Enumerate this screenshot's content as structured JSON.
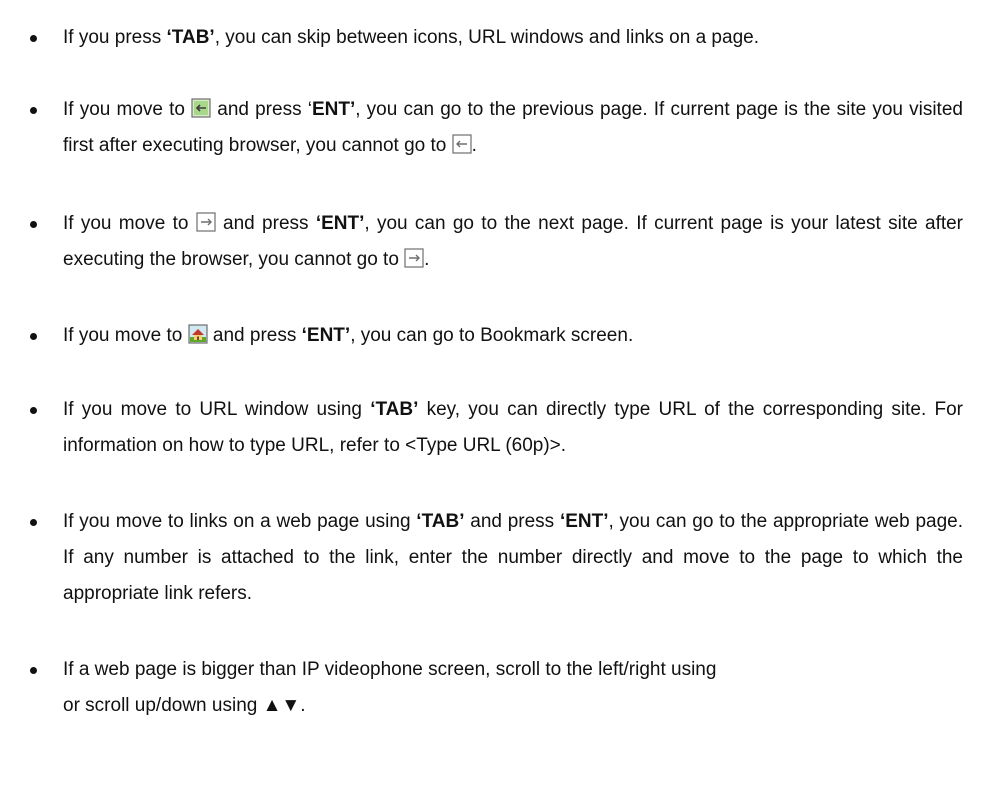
{
  "bullets": [
    {
      "p1": "If you press ",
      "k1": "‘TAB’",
      "p2": ", you can skip between icons, URL windows and links on a page."
    },
    {
      "p1": "If you move to ",
      "p2": " and press ‘",
      "k1": "ENT’",
      "p3": ", you can go to the previous page. If current page is the site you visited first after executing browser, you cannot go to ",
      "p4": "."
    },
    {
      "p1": "If you move to ",
      "p2": " and press ",
      "k1": "‘ENT’",
      "p3": ", you can go to the next page. If current page is your latest site after executing the browser, you cannot go to ",
      "p4": "."
    },
    {
      "p1": "If you move to ",
      "p2": " and press ",
      "k1": "‘ENT’",
      "p3": ", you can go to Bookmark screen."
    },
    {
      "p1": "If you move to URL window using ",
      "k1": "‘TAB’",
      "p2": " key, you can directly type URL of the corresponding site. For information on how to type URL, refer to <Type URL (60p)>."
    },
    {
      "p1": "If you move to links on a web page using ",
      "k1": "‘TAB’",
      "p2": " and press ",
      "k2": "‘ENT’",
      "p3": ", you can go to the appropriate web page. If any number is attached to the link, enter the number directly and move to the page to which the appropriate link refers."
    },
    {
      "p1": "If a web page is bigger than IP videophone screen, scroll to the left/right using",
      "p2": "or scroll up/down using ",
      "arrows": "▲▼",
      "p3": "."
    }
  ],
  "icons": {
    "back": "back-arrow-icon",
    "forward": "forward-arrow-icon",
    "home": "home-bookmark-icon"
  },
  "colors": {
    "text": "#111111",
    "icon_border": "#6e6e6e",
    "icon_green": "#5fa82a",
    "icon_roof": "#c0392b"
  }
}
